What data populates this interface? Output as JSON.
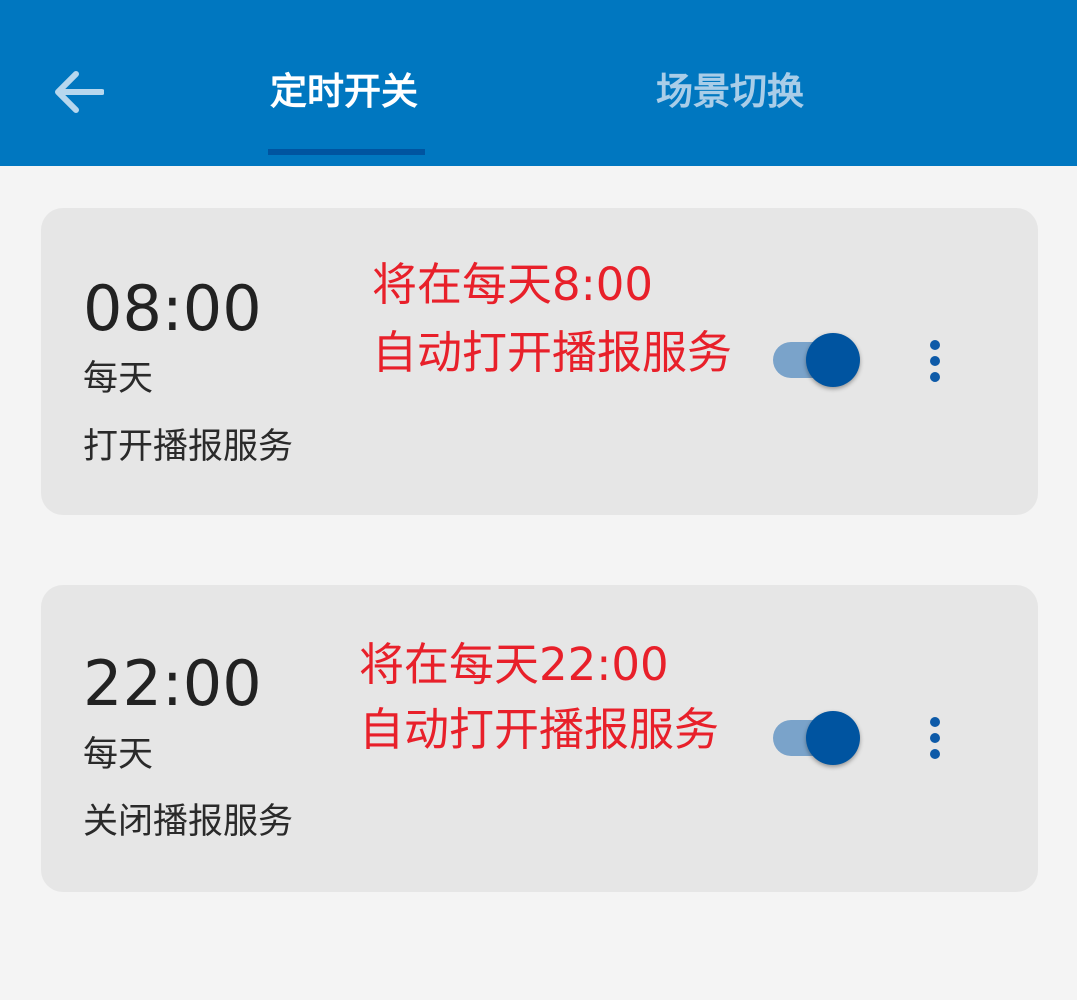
{
  "header": {
    "tabs": [
      {
        "label": "定时开关",
        "active": true
      },
      {
        "label": "场景切换",
        "active": false
      }
    ]
  },
  "timers": [
    {
      "time": "08:00",
      "repeat": "每天",
      "action": "打开播报服务",
      "note_line1": "将在每天8:00",
      "note_line2": "自动打开播报服务",
      "enabled": true
    },
    {
      "time": "22:00",
      "repeat": "每天",
      "action": "关闭播报服务",
      "note_line1": "将在每天22:00",
      "note_line2": "自动打开播报服务",
      "enabled": true
    }
  ],
  "colors": {
    "header_bg": "#0077c0",
    "tab_indicator": "#0054a0",
    "annotation": "#e8202a",
    "toggle_on": "#0054a0"
  },
  "icons": {
    "back": "arrow-left-icon",
    "more": "more-vertical-icon"
  }
}
